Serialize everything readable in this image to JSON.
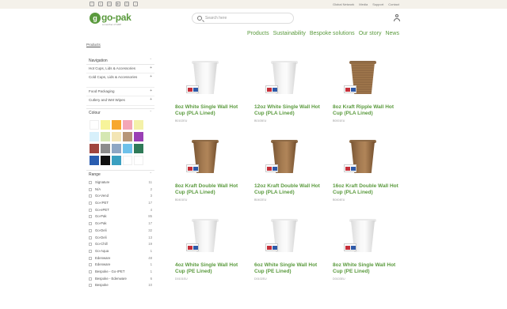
{
  "topbar": {
    "social_icons": [
      "facebook-icon",
      "x-icon",
      "linkedin-icon",
      "youtube-icon",
      "instagram-icon",
      "tiktok-icon"
    ],
    "links": [
      "Global Network",
      "Media",
      "Support",
      "Contact"
    ]
  },
  "header": {
    "logo_mark": "g",
    "logo_text": "go-pak",
    "logo_sub": "a member of GDP",
    "search_placeholder": "Search here",
    "nav": [
      "Products",
      "Sustainability",
      "Bespoke solutions",
      "Our story",
      "News"
    ]
  },
  "breadcrumb": "Products",
  "sidebar": {
    "navigation_title": "Navigation",
    "navigation_items": [
      "Hot Cups, Lids & Accessories",
      "Cold Cups, Lids & Accessories",
      "Food Packaging",
      "Cutlery and Wet Wipes"
    ],
    "colour_title": "Colour",
    "colours": [
      "#ffffff",
      "#f7f49a",
      "#f7a72f",
      "#f4a6b7",
      "#f4f1a8",
      "#d7f0fb",
      "#d5e7b3",
      "#f3e5b5",
      "#b79677",
      "#9a3fb5",
      "#a0453f",
      "#8c8c8c",
      "#8ea6c4",
      "#6ec1ea",
      "#2f7a58",
      "#2a5db0",
      "#111111",
      "#3a9fc0",
      "#ffffff",
      "#ffffff"
    ],
    "range_title": "Range",
    "range": [
      {
        "label": "Signature",
        "count": "11"
      },
      {
        "label": "N/A",
        "count": "2"
      },
      {
        "label": "Go-Vend",
        "count": "3"
      },
      {
        "label": "Go-rPET",
        "count": "17"
      },
      {
        "label": "Go-ePET",
        "count": "4"
      },
      {
        "label": "Go-Pak",
        "count": "85"
      },
      {
        "label": "Go-Pak",
        "count": "17"
      },
      {
        "label": "Go-Deli",
        "count": "32"
      },
      {
        "label": "Go-Deli",
        "count": "13"
      },
      {
        "label": "Go-Chill",
        "count": "19"
      },
      {
        "label": "Go-Aqua",
        "count": "1"
      },
      {
        "label": "Edenware",
        "count": "48"
      },
      {
        "label": "Edenware",
        "count": "1"
      },
      {
        "label": "Bespoke - Go-rPET",
        "count": "1"
      },
      {
        "label": "Bespoke - Edenware",
        "count": "6"
      },
      {
        "label": "Bespoke",
        "count": "10"
      }
    ]
  },
  "products": [
    {
      "title": "8oz White Single Wall Hot Cup (PLA Lined)",
      "sku": "B0102EU",
      "style": "white"
    },
    {
      "title": "12oz White Single Wall Hot Cup (PLA Lined)",
      "sku": "B0105EU",
      "style": "white"
    },
    {
      "title": "8oz Kraft Ripple Wall Hot Cup (PLA Lined)",
      "sku": "B0001EU",
      "style": "ripple"
    },
    {
      "title": "8oz Kraft Double Wall Hot Cup (PLA Lined)",
      "sku": "B0401EU",
      "style": "kraft"
    },
    {
      "title": "12oz Kraft Double Wall Hot Cup (PLA Lined)",
      "sku": "B0402EU",
      "style": "kraft"
    },
    {
      "title": "16oz Kraft Double Wall Hot Cup (PLA Lined)",
      "sku": "B0404EU",
      "style": "kraft"
    },
    {
      "title": "4oz White Single Wall Hot Cup (PE Lined)",
      "sku": "D0101EU",
      "style": "white"
    },
    {
      "title": "6oz White Single Wall Hot Cup (PE Lined)",
      "sku": "D0102EU",
      "style": "white"
    },
    {
      "title": "8oz White Single Wall Hot Cup (PE Lined)",
      "sku": "D0103EU",
      "style": "white"
    }
  ]
}
